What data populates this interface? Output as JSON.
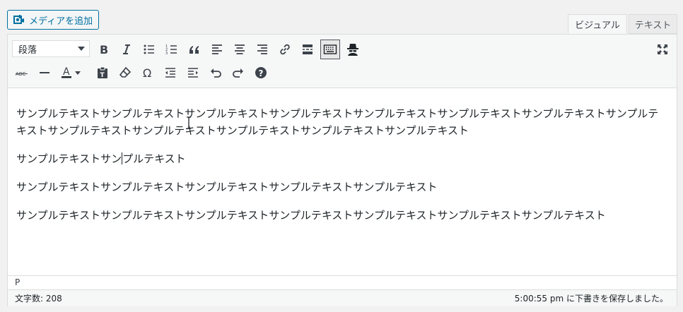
{
  "media": {
    "label": "メディアを追加",
    "icon": "add-media-icon"
  },
  "tabs": [
    {
      "label": "ビジュアル"
    },
    {
      "label": "テキスト"
    }
  ],
  "toolbar": {
    "format_select": "段落",
    "row1": [
      "bold-icon",
      "italic-icon",
      "bulleted-list-icon",
      "numbered-list-icon",
      "blockquote-icon",
      "align-left-icon",
      "align-center-icon",
      "align-right-icon",
      "link-icon",
      "read-more-icon",
      "toolbar-toggle-icon",
      "spy-icon"
    ],
    "fullscreen": "fullscreen-icon",
    "row2": [
      "strikethrough-icon",
      "horizontal-line-icon",
      "text-color-icon",
      "paste-text-icon",
      "clear-formatting-icon",
      "special-character-icon",
      "outdent-icon",
      "indent-icon",
      "undo-icon",
      "redo-icon",
      "help-icon"
    ],
    "text_color": {
      "glyph": "A",
      "color": "#1d2327"
    },
    "strike_glyph": "ABC",
    "omega_glyph": "Ω",
    "help_glyph": "?"
  },
  "content": {
    "paragraphs": [
      "サンプルテキストサンプルテキストサンプルテキストサンプルテキストサンプルテキストサンプルテキストサンプルテキストサンプルテキストサンプルテキストサンプルテキストサンプルテキストサンプルテキストサンプルテキスト",
      "サンプルテキストサンプルテキスト",
      "サンプルテキストサンプルテキストサンプルテキストサンプルテキストサンプルテキスト",
      "サンプルテキストサンプルテキストサンプルテキストサンプルテキストサンプルテキストサンプルテキストサンプルテキスト"
    ],
    "p2_before_cursor": "サンプルテキストサン",
    "p2_after_cursor": "プルテキスト"
  },
  "path": "P",
  "status": {
    "word_count": "文字数: 208",
    "saved": "5:00:55 pm に下書きを保存しました。"
  },
  "colors": {
    "accent": "#0071a1",
    "border": "#dcdcde",
    "toolbar_bg": "#f6f7f7"
  }
}
